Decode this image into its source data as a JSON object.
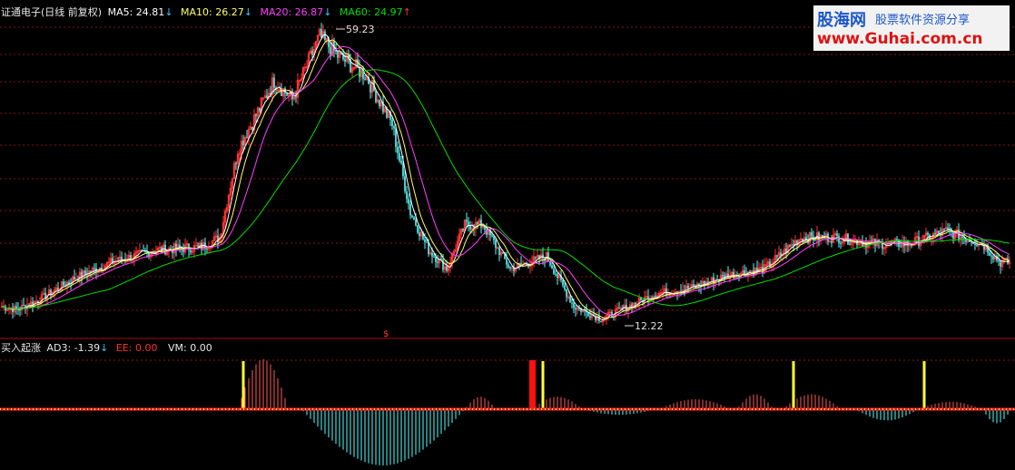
{
  "header": {
    "title": "证通电子(日线 前复权)",
    "ma5_label": "MA5: 24.81",
    "ma10_label": "MA10: 26.27",
    "ma20_label": "MA20: 26.87",
    "ma60_label": "MA60: 24.97",
    "arrow_down": "↓",
    "arrow_up": "↑",
    "colors": {
      "ma5": "#ffffff",
      "ma10": "#ffff66",
      "ma20": "#ff40ff",
      "ma60": "#00dd00"
    }
  },
  "indicator_header": {
    "title": "买入起涨",
    "ad3_label": "AD3: -1.39",
    "ad3_arrow": "↓",
    "ee_label": "EE: 0.00",
    "vm_label": "VM: 0.00"
  },
  "watermark": {
    "site_name": "股海网",
    "tagline": "股票软件资源分享",
    "url": "www.Guhai.com.cn"
  },
  "chart_data": [
    {
      "type": "candlestick",
      "title": "证通电子(日线 前复权)",
      "annotations": {
        "high_label": "59.23",
        "low_label": "12.22",
        "marker": "$"
      },
      "price_levels": [
        59.23,
        55,
        50,
        45,
        40,
        35,
        30,
        25,
        20,
        15,
        12.22
      ],
      "close_anchors": [
        [
          0,
          15.0
        ],
        [
          8,
          14.5
        ],
        [
          20,
          16.0
        ],
        [
          40,
          19.5
        ],
        [
          60,
          22.0
        ],
        [
          85,
          24.0
        ],
        [
          110,
          24.5
        ],
        [
          120,
          26.0
        ],
        [
          130,
          40.0
        ],
        [
          150,
          51.0
        ],
        [
          160,
          48.0
        ],
        [
          175,
          58.0
        ],
        [
          185,
          55.0
        ],
        [
          200,
          52.0
        ],
        [
          215,
          44.0
        ],
        [
          225,
          30.0
        ],
        [
          235,
          24.0
        ],
        [
          245,
          21.0
        ],
        [
          255,
          28.0
        ],
        [
          265,
          28.0
        ],
        [
          280,
          21.0
        ],
        [
          300,
          23.0
        ],
        [
          315,
          15.0
        ],
        [
          330,
          13.0
        ],
        [
          345,
          15.0
        ],
        [
          360,
          17.0
        ],
        [
          380,
          18.0
        ],
        [
          400,
          20.0
        ],
        [
          420,
          21.0
        ],
        [
          440,
          26.0
        ],
        [
          460,
          26.0
        ],
        [
          480,
          25.0
        ],
        [
          500,
          25.0
        ],
        [
          520,
          27.0
        ],
        [
          540,
          25.0
        ],
        [
          550,
          22.0
        ]
      ],
      "moving_averages": [
        {
          "name": "MA5",
          "value": 24.81
        },
        {
          "name": "MA10",
          "value": 26.27
        },
        {
          "name": "MA20",
          "value": 26.87
        },
        {
          "name": "MA60",
          "value": 24.97
        }
      ]
    },
    {
      "type": "bar",
      "title": "买入起涨",
      "series": [
        {
          "name": "AD3",
          "value": -1.39
        },
        {
          "name": "EE",
          "value": 0.0
        },
        {
          "name": "VM",
          "value": 0.0
        }
      ],
      "positive_humps": [
        [
          130,
          158,
          1.0
        ],
        [
          255,
          272,
          0.25
        ],
        [
          292,
          320,
          0.25
        ],
        [
          362,
          402,
          0.2
        ],
        [
          405,
          425,
          0.3
        ],
        [
          430,
          462,
          0.3
        ],
        [
          505,
          540,
          0.15
        ]
      ],
      "negative_humps": [
        [
          165,
          255,
          1.0
        ],
        [
          320,
          360,
          0.1
        ],
        [
          470,
          505,
          0.2
        ],
        [
          540,
          556,
          0.25
        ]
      ],
      "signal_days": [
        133,
        298,
        436,
        508
      ],
      "strong_signal_day": 292
    }
  ]
}
